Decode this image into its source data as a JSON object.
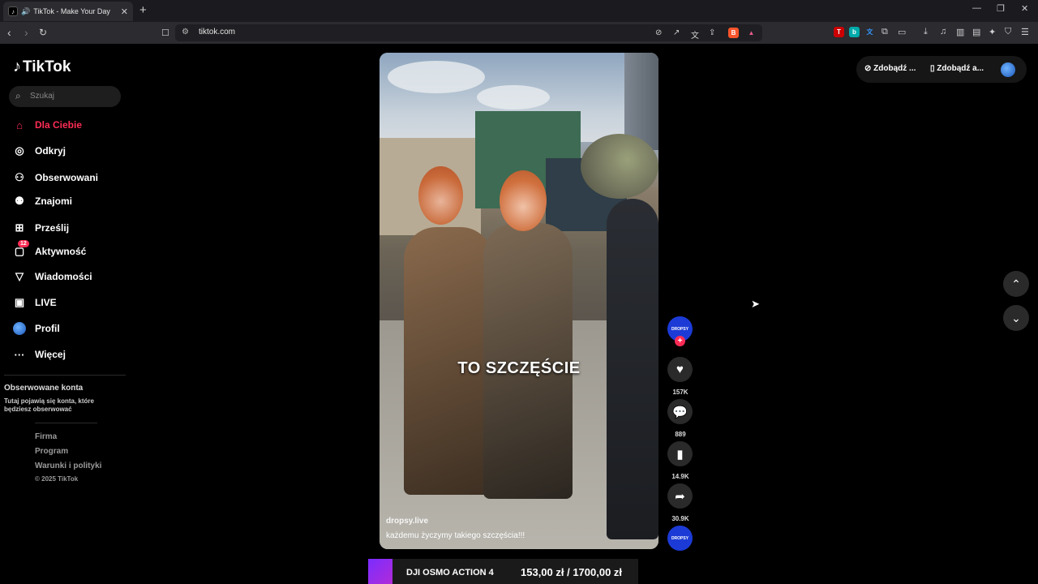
{
  "browser": {
    "tab_title": "TikTok - Make Your Day",
    "url": "tiktok.com",
    "new_tab": "+",
    "window_controls": [
      "—",
      "❐",
      "✕"
    ]
  },
  "sidebar": {
    "logo": "TikTok",
    "search_placeholder": "Szukaj",
    "items": [
      {
        "label": "Dla Ciebie",
        "icon": "home-icon"
      },
      {
        "label": "Odkryj",
        "icon": "compass-icon"
      },
      {
        "label": "Obserwowani",
        "icon": "user-follow-icon"
      },
      {
        "label": "Znajomi",
        "icon": "friends-icon"
      },
      {
        "label": "Prześlij",
        "icon": "upload-icon"
      },
      {
        "label": "Aktywność",
        "icon": "inbox-icon",
        "badge": "12"
      },
      {
        "label": "Wiadomości",
        "icon": "send-icon"
      },
      {
        "label": "LIVE",
        "icon": "live-icon"
      },
      {
        "label": "Profil",
        "icon": "avatar-icon"
      },
      {
        "label": "Więcej",
        "icon": "more-icon"
      }
    ],
    "followed_title": "Obserwowane konta",
    "followed_desc": "Tutaj pojawią się konta, które będziesz obserwować",
    "footer_links": [
      "Firma",
      "Program",
      "Warunki i polityki"
    ],
    "copyright": "© 2025 TikTok"
  },
  "video": {
    "caption_overlay": "TO SZCZĘŚCIE",
    "username": "dropsy.live",
    "description": "każdemu życzymy takiego szczęścia!!!"
  },
  "actions": {
    "creator_label": "DROPSY",
    "likes": "157K",
    "comments": "889",
    "saves": "14.9K",
    "shares": "30.9K"
  },
  "topright": {
    "coins_button": "Zdobądź ...",
    "app_button": "Zdobądź a..."
  },
  "ad": {
    "product": "DJI OSMO ACTION 4",
    "price": "153,00 zł / 1700,00 zł"
  }
}
